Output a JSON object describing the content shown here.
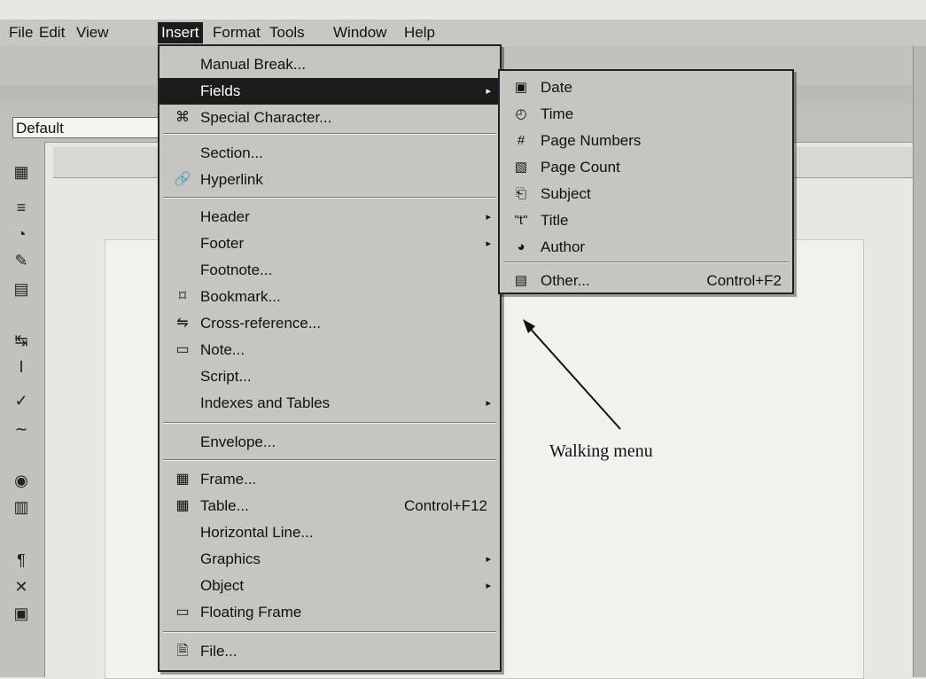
{
  "menubar": {
    "items": [
      "File",
      "Edit",
      "View",
      "Insert",
      "Format",
      "Tools",
      "Window",
      "Help"
    ],
    "active": "Insert"
  },
  "toolbar": {
    "style_value": "Default"
  },
  "insert_menu": {
    "items": [
      {
        "label": "Manual Break...",
        "icon": "",
        "submenu": false,
        "shortcut": ""
      },
      {
        "label": "Fields",
        "icon": "",
        "submenu": true,
        "shortcut": "",
        "highlighted": true
      },
      {
        "label": "Special Character...",
        "icon": "command-icon",
        "submenu": false,
        "shortcut": ""
      },
      {
        "label": "Section...",
        "icon": "",
        "submenu": false,
        "shortcut": ""
      },
      {
        "label": "Hyperlink",
        "icon": "hyperlink-icon",
        "submenu": false,
        "shortcut": ""
      },
      {
        "label": "Header",
        "icon": "",
        "submenu": true,
        "shortcut": ""
      },
      {
        "label": "Footer",
        "icon": "",
        "submenu": true,
        "shortcut": ""
      },
      {
        "label": "Footnote...",
        "icon": "",
        "submenu": false,
        "shortcut": ""
      },
      {
        "label": "Bookmark...",
        "icon": "bookmark-icon",
        "submenu": false,
        "shortcut": ""
      },
      {
        "label": "Cross-reference...",
        "icon": "cross-reference-icon",
        "submenu": false,
        "shortcut": ""
      },
      {
        "label": "Note...",
        "icon": "note-icon",
        "submenu": false,
        "shortcut": ""
      },
      {
        "label": "Script...",
        "icon": "",
        "submenu": false,
        "shortcut": ""
      },
      {
        "label": "Indexes and Tables",
        "icon": "",
        "submenu": true,
        "shortcut": ""
      },
      {
        "label": "Envelope...",
        "icon": "",
        "submenu": false,
        "shortcut": ""
      },
      {
        "label": "Frame...",
        "icon": "frame-icon",
        "submenu": false,
        "shortcut": ""
      },
      {
        "label": "Table...",
        "icon": "table-icon",
        "submenu": false,
        "shortcut": "Control+F12"
      },
      {
        "label": "Horizontal Line...",
        "icon": "",
        "submenu": false,
        "shortcut": ""
      },
      {
        "label": "Graphics",
        "icon": "",
        "submenu": true,
        "shortcut": ""
      },
      {
        "label": "Object",
        "icon": "",
        "submenu": true,
        "shortcut": ""
      },
      {
        "label": "Floating Frame",
        "icon": "floating-frame-icon",
        "submenu": false,
        "shortcut": ""
      },
      {
        "label": "File...",
        "icon": "file-icon",
        "submenu": false,
        "shortcut": ""
      }
    ]
  },
  "fields_submenu": {
    "items": [
      {
        "label": "Date",
        "icon": "date-icon",
        "shortcut": ""
      },
      {
        "label": "Time",
        "icon": "time-icon",
        "shortcut": ""
      },
      {
        "label": "Page Numbers",
        "icon": "page-numbers-icon",
        "shortcut": ""
      },
      {
        "label": "Page Count",
        "icon": "page-count-icon",
        "shortcut": ""
      },
      {
        "label": "Subject",
        "icon": "subject-icon",
        "shortcut": ""
      },
      {
        "label": "Title",
        "icon": "title-icon",
        "shortcut": ""
      },
      {
        "label": "Author",
        "icon": "author-icon",
        "shortcut": ""
      },
      {
        "label": "Other...",
        "icon": "other-icon",
        "shortcut": "Control+F2"
      }
    ]
  },
  "annotation": {
    "label": "Walking menu"
  }
}
